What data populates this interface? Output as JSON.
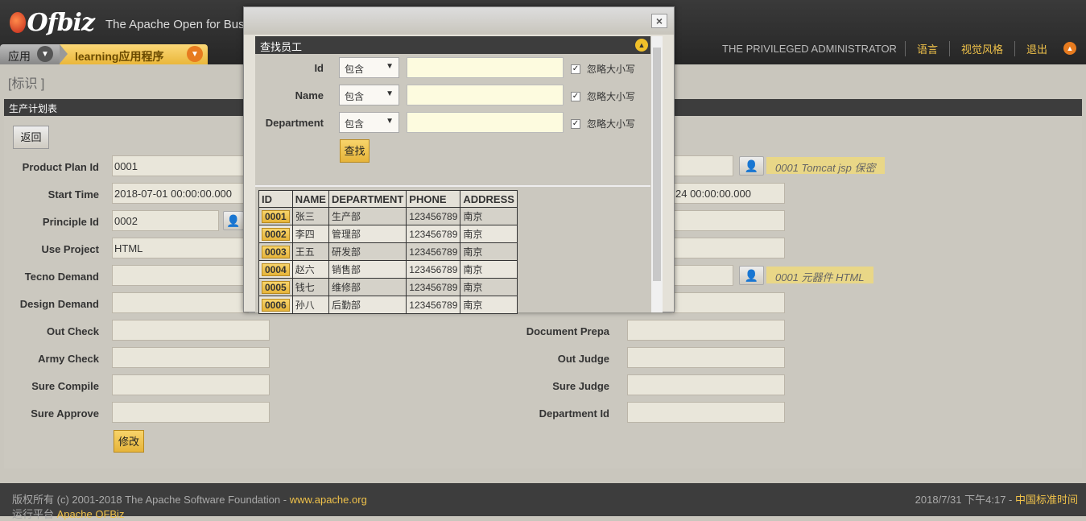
{
  "header": {
    "logo_text": "Ofbiz",
    "tagline": "The Apache Open for Busi",
    "app_tab_label": "应用",
    "learning_tab_label": "learning应用程序",
    "admin_name": "THE PRIVILEGED ADMINISTRATOR",
    "language_link": "语言",
    "visual_link": "视觉风格",
    "logout_link": "退出"
  },
  "breadcrumb": "[标识 ]",
  "section_title": "生产计划表",
  "form": {
    "back_button": "返回",
    "modify_button": "修改",
    "left_fields": [
      {
        "label": "Product Plan Id",
        "value": "0001"
      },
      {
        "label": "Start Time",
        "value": "2018-07-01 00:00:00.000"
      },
      {
        "label": "Principle Id",
        "value": "0002"
      },
      {
        "label": "Use Project",
        "value": "HTML"
      },
      {
        "label": "Tecno Demand",
        "value": ""
      },
      {
        "label": "Design Demand",
        "value": ""
      },
      {
        "label": "Out Check",
        "value": ""
      },
      {
        "label": "Army Check",
        "value": ""
      },
      {
        "label": "Sure Compile",
        "value": ""
      },
      {
        "label": "Sure Approve",
        "value": ""
      }
    ],
    "right_partial": [
      {
        "value": ""
      },
      {
        "value": "24 00:00:00.000"
      },
      {
        "value": ""
      },
      {
        "value": ""
      },
      {
        "value": ""
      },
      {
        "value": ""
      }
    ],
    "right_fields": [
      {
        "label": "Document Prepa",
        "value": ""
      },
      {
        "label": "Out Judge",
        "value": ""
      },
      {
        "label": "Sure Judge",
        "value": ""
      },
      {
        "label": "Department Id",
        "value": ""
      }
    ],
    "lookup_desc_1": "0001 Tomcat jsp 保密",
    "lookup_desc_2": "0001 元器件 HTML"
  },
  "modal": {
    "title": "查找员工",
    "close_label": "×",
    "filters": [
      {
        "label": "Id",
        "operator": "包含",
        "value": "",
        "ignore_case_label": "忽略大小写",
        "ignore_case": true
      },
      {
        "label": "Name",
        "operator": "包含",
        "value": "",
        "ignore_case_label": "忽略大小写",
        "ignore_case": true
      },
      {
        "label": "Department",
        "operator": "包含",
        "value": "",
        "ignore_case_label": "忽略大小写",
        "ignore_case": true
      }
    ],
    "search_button": "查找",
    "table": {
      "headers": [
        "ID",
        "NAME",
        "DEPARTMENT",
        "PHONE",
        "ADDRESS"
      ],
      "rows": [
        [
          "0001",
          "张三",
          "生产部",
          "123456789",
          "南京"
        ],
        [
          "0002",
          "李四",
          "管理部",
          "123456789",
          "南京"
        ],
        [
          "0003",
          "王五",
          "研发部",
          "123456789",
          "南京"
        ],
        [
          "0004",
          "赵六",
          "销售部",
          "123456789",
          "南京"
        ],
        [
          "0005",
          "钱七",
          "维修部",
          "123456789",
          "南京"
        ],
        [
          "0006",
          "孙八",
          "后勤部",
          "123456789",
          "南京"
        ]
      ]
    }
  },
  "footer": {
    "copyright_prefix": "版权所有 (c) 2001-2018 The Apache Software Foundation - ",
    "apache_link": "www.apache.org",
    "runtime_prefix": "运行平台 ",
    "runtime_link": "Apache OFBiz",
    "datetime": "2018/7/31 下午4:17 - ",
    "timezone": "中国标准时间"
  }
}
